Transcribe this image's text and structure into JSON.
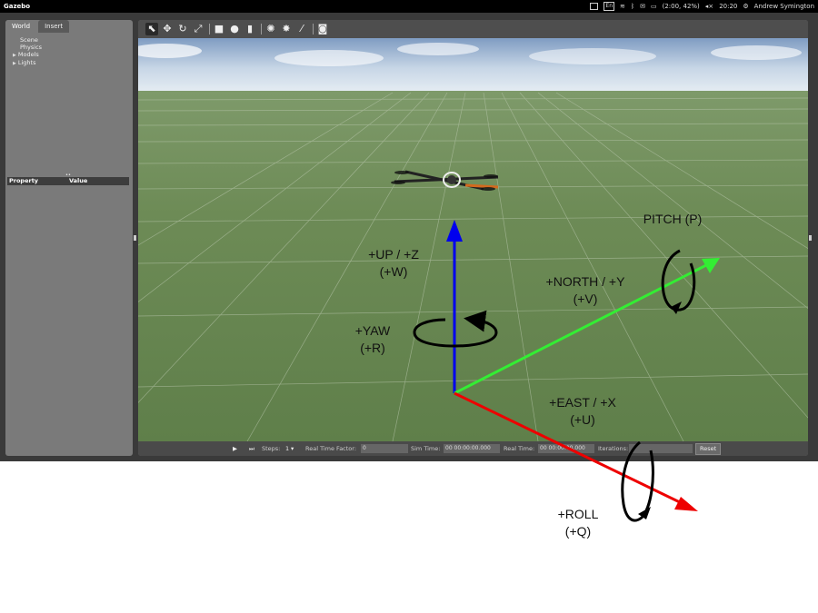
{
  "window": {
    "title": "Gazebo"
  },
  "tray": {
    "keyboard": "En",
    "battery": "(2:00, 42%)",
    "clock": "20:20",
    "user": "Andrew Symington"
  },
  "left_panel": {
    "tabs": [
      {
        "label": "World",
        "active": true
      },
      {
        "label": "Insert",
        "active": false
      }
    ],
    "tree": [
      {
        "label": "Scene",
        "expandable": false
      },
      {
        "label": "Physics",
        "expandable": false
      },
      {
        "label": "Models",
        "expandable": true
      },
      {
        "label": "Lights",
        "expandable": true
      }
    ],
    "property_header": {
      "property": "Property",
      "value": "Value"
    }
  },
  "toolbar": {
    "tools": [
      {
        "name": "select-mode-icon",
        "glyph": "⬉",
        "selected": true
      },
      {
        "name": "translate-mode-icon",
        "glyph": "✥",
        "selected": false
      },
      {
        "name": "rotate-mode-icon",
        "glyph": "↻",
        "selected": false
      },
      {
        "name": "scale-mode-icon",
        "glyph": "⤢",
        "selected": false
      },
      {
        "name": "box-shape-icon",
        "glyph": "■",
        "selected": false
      },
      {
        "name": "sphere-shape-icon",
        "glyph": "●",
        "selected": false
      },
      {
        "name": "cylinder-shape-icon",
        "glyph": "▮",
        "selected": false
      },
      {
        "name": "point-light-icon",
        "glyph": "✺",
        "selected": false
      },
      {
        "name": "spot-light-icon",
        "glyph": "✸",
        "selected": false
      },
      {
        "name": "directional-light-icon",
        "glyph": "⁄",
        "selected": false
      },
      {
        "name": "screenshot-icon",
        "glyph": "◙",
        "selected": false
      }
    ]
  },
  "bottom_bar": {
    "play_glyph": "▶",
    "step_glyph": "⏭",
    "steps_label": "Steps:",
    "steps_value": "1",
    "rtf_label": "Real Time Factor:",
    "rtf_value": "0",
    "sim_time_label": "Sim Time:",
    "sim_time_value": "00 00:00:00.000",
    "real_time_label": "Real Time:",
    "real_time_value": "00 00:00:00.000",
    "iterations_label": "Iterations:",
    "iterations_value": "",
    "reset_label": "Reset"
  },
  "annotations": {
    "up": {
      "line1": "+UP / +Z",
      "line2": "(+W)"
    },
    "yaw": {
      "line1": "+YAW",
      "line2": "(+R)"
    },
    "pitch": {
      "line1": "PITCH (P)"
    },
    "north": {
      "line1": "+NORTH / +Y",
      "line2": "(+V)"
    },
    "east": {
      "line1": "+EAST / +X",
      "line2": "(+U)"
    },
    "roll": {
      "line1": "+ROLL",
      "line2": "(+Q)"
    }
  },
  "colors": {
    "axis_up": "#0000ee",
    "axis_north": "#33ee33",
    "axis_east": "#ee0000",
    "sky_top": "#8fa9c8",
    "ground": "#6b8a52"
  }
}
